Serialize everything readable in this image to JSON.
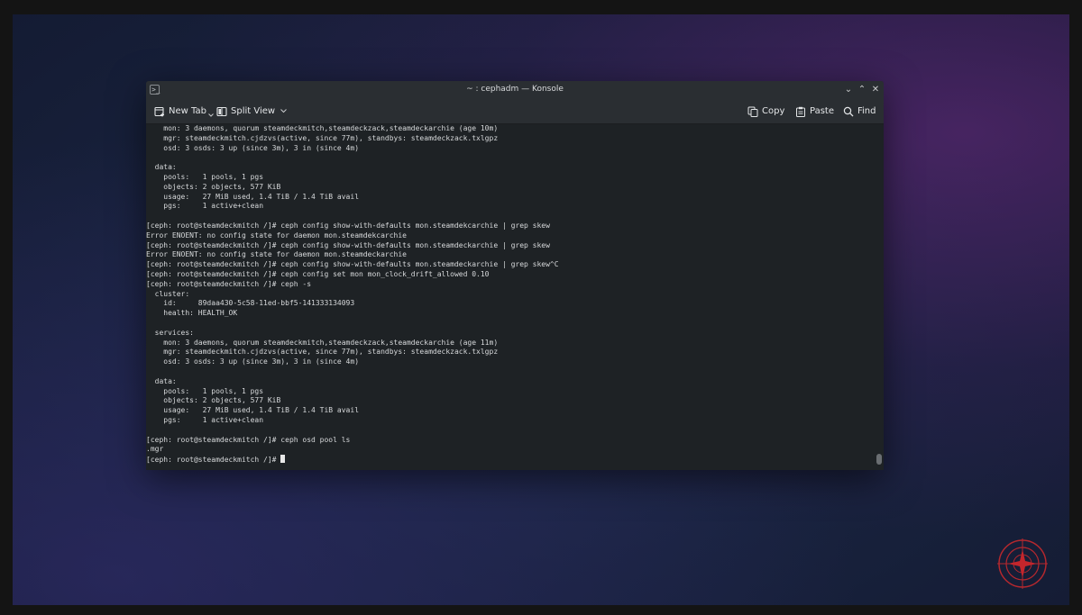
{
  "window": {
    "title": "~ : cephadm — Konsole",
    "app_icon_glyph": ">_",
    "controls": {
      "minimize": "⌄",
      "maximize": "⌃",
      "close": "✕"
    }
  },
  "toolbar": {
    "new_tab_label": "New Tab",
    "split_view_label": "Split View",
    "copy_label": "Copy",
    "paste_label": "Paste",
    "find_label": "Find"
  },
  "terminal": {
    "lines": [
      "    mon: 3 daemons, quorum steamdeckmitch,steamdeckzack,steamdeckarchie (age 10m)",
      "    mgr: steamdeckmitch.cjdzvs(active, since 77m), standbys: steamdeckzack.txlgpz",
      "    osd: 3 osds: 3 up (since 3m), 3 in (since 4m)",
      "",
      "  data:",
      "    pools:   1 pools, 1 pgs",
      "    objects: 2 objects, 577 KiB",
      "    usage:   27 MiB used, 1.4 TiB / 1.4 TiB avail",
      "    pgs:     1 active+clean",
      "",
      "[ceph: root@steamdeckmitch /]# ceph config show-with-defaults mon.steamdekcarchie | grep skew",
      "Error ENOENT: no config state for daemon mon.steamdekcarchie",
      "[ceph: root@steamdeckmitch /]# ceph config show-with-defaults mon.steamdeckarchie | grep skew",
      "Error ENOENT: no config state for daemon mon.steamdeckarchie",
      "[ceph: root@steamdeckmitch /]# ceph config show-with-defaults mon.steamdeckarchie | grep skew^C",
      "[ceph: root@steamdeckmitch /]# ceph config set mon mon_clock_drift_allowed 0.10",
      "[ceph: root@steamdeckmitch /]# ceph -s",
      "  cluster:",
      "    id:     89daa430-5c58-11ed-bbf5-141333134093",
      "    health: HEALTH_OK",
      "",
      "  services:",
      "    mon: 3 daemons, quorum steamdeckmitch,steamdeckzack,steamdeckarchie (age 11m)",
      "    mgr: steamdeckmitch.cjdzvs(active, since 77m), standbys: steamdeckzack.txlgpz",
      "    osd: 3 osds: 3 up (since 3m), 3 in (since 4m)",
      "",
      "  data:",
      "    pools:   1 pools, 1 pgs",
      "    objects: 2 objects, 577 KiB",
      "    usage:   27 MiB used, 1.4 TiB / 1.4 TiB avail",
      "    pgs:     1 active+clean",
      "",
      "[ceph: root@steamdeckmitch /]# ceph osd pool ls",
      ".mgr"
    ],
    "prompt": "[ceph: root@steamdeckmitch /]# "
  }
}
